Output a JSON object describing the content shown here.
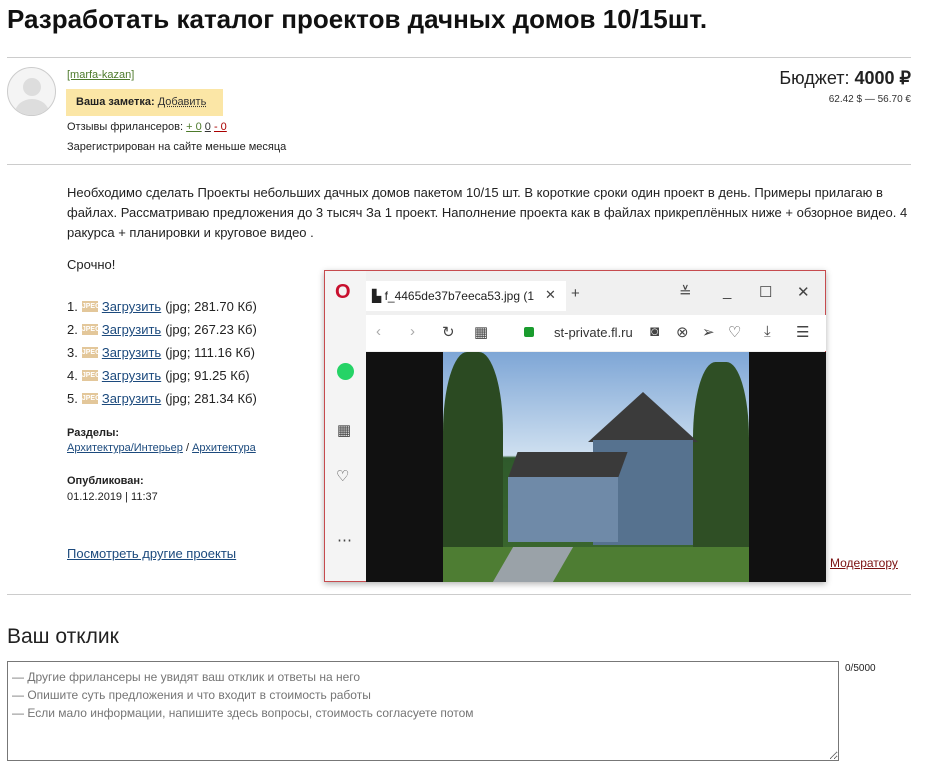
{
  "title": "Разработать каталог проектов дачных домов 10/15шт.",
  "user": {
    "name": "[marfa-kazan]",
    "note_label": "Ваша заметка:",
    "note_add": "Добавить",
    "reviews_label": "Отзывы фрилансеров:",
    "reviews_pos": "+ 0",
    "reviews_neutral": "0",
    "reviews_neg": "- 0",
    "registered": "Зарегистрирован на сайте меньше месяца"
  },
  "budget": {
    "label": "Бюджет:",
    "value": "4000 ₽",
    "conversion": "62.42 $ — 56.70 €"
  },
  "description": "Необходимо сделать Проекты небольших дачных домов пакетом 10/15 шт. В короткие сроки один проект в день. Примеры прилагаю в файлах. Рассматриваю предложения до 3 тысяч За 1 проект. Наполнение проекта как в файлах прикреплённых ниже + обзорное видео. 4 ракурса + планировки и круговое видео .",
  "urgent": "Срочно!",
  "files": [
    {
      "num": "1.",
      "link": "Загрузить",
      "info": "(jpg; 281.70 Кб)"
    },
    {
      "num": "2.",
      "link": "Загрузить",
      "info": "(jpg; 267.23 Кб)"
    },
    {
      "num": "3.",
      "link": "Загрузить",
      "info": "(jpg; 111.16 Кб)"
    },
    {
      "num": "4.",
      "link": "Загрузить",
      "info": "(jpg; 91.25 Кб)"
    },
    {
      "num": "5.",
      "link": "Загрузить",
      "info": "(jpg; 281.34 Кб)"
    }
  ],
  "file_icon_text": "JPEG",
  "sections": {
    "label": "Разделы:",
    "items": [
      "Архитектура/Интерьер",
      "Архитектура"
    ],
    "sep": "/"
  },
  "published": {
    "label": "Опубликован:",
    "value": "01.12.2019 | 11:37"
  },
  "other_projects": "Посмотреть другие проекты",
  "moderator": "Модератору",
  "response": {
    "title": "Ваш отклик",
    "placeholder": "— Другие фрилансеры не увидят ваш отклик и ответы на него\n— Опишите суть предложения и что входит в стоимость работы\n— Если мало информации, напишите здесь вопросы, стоимость согласуете потом",
    "counter": "0/5000"
  },
  "popup": {
    "tab_title": "f_4465de37b7eeca53.jpg (1",
    "url": "st-private.fl.ru",
    "accent": "#c8102e"
  }
}
